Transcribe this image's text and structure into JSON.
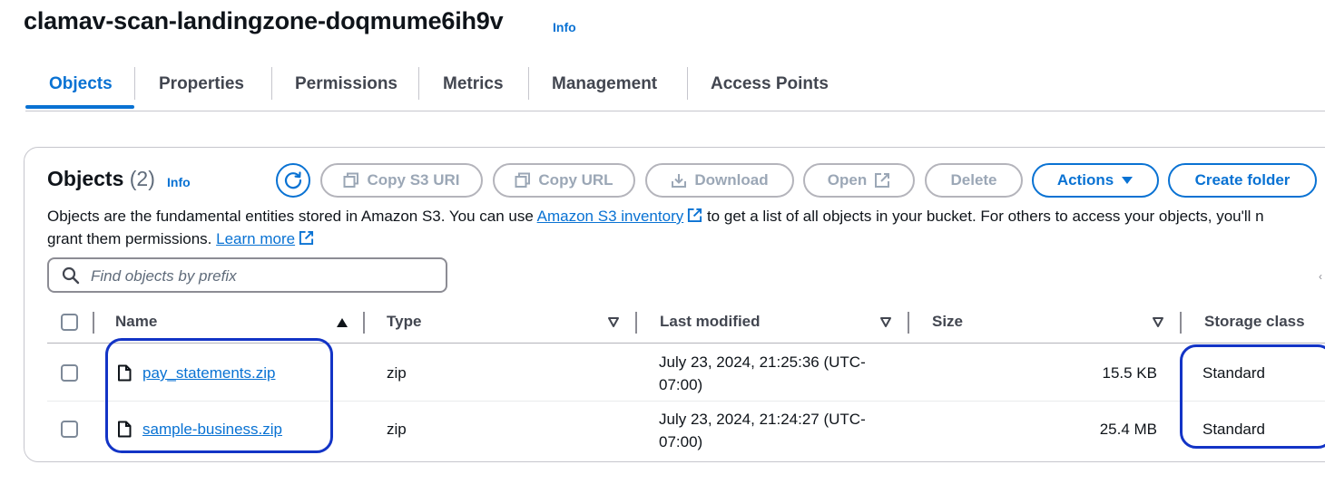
{
  "bucket": {
    "title": "clamav-scan-landingzone-doqmume6ih9v",
    "info": "Info"
  },
  "tabs": [
    {
      "label": "Objects",
      "active": true
    },
    {
      "label": "Properties"
    },
    {
      "label": "Permissions"
    },
    {
      "label": "Metrics"
    },
    {
      "label": "Management"
    },
    {
      "label": "Access Points"
    }
  ],
  "objects_panel": {
    "title": "Objects",
    "count": "(2)",
    "info": "Info",
    "buttons": {
      "copy_s3_uri": "Copy S3 URI",
      "copy_url": "Copy URL",
      "download": "Download",
      "open": "Open",
      "delete": "Delete",
      "actions": "Actions",
      "create_folder": "Create folder"
    },
    "description": {
      "part1": "Objects are the fundamental entities stored in Amazon S3. You can use ",
      "inventory_link": "Amazon S3 inventory",
      "part2": " to get a list of all objects in your bucket. For others to access your objects, you'll n",
      "part3": "grant them permissions. ",
      "learn_more": "Learn more"
    },
    "search": {
      "placeholder": "Find objects by prefix",
      "value": ""
    },
    "columns": {
      "name": "Name",
      "type": "Type",
      "last_modified": "Last modified",
      "size": "Size",
      "storage_class": "Storage class"
    },
    "rows": [
      {
        "name": "pay_statements.zip",
        "type": "zip",
        "last_modified_1": "July 23, 2024, 21:25:36 (UTC-",
        "last_modified_2": "07:00)",
        "size": "15.5 KB",
        "storage_class": "Standard"
      },
      {
        "name": "sample-business.zip",
        "type": "zip",
        "last_modified_1": "July 23, 2024, 21:24:27 (UTC-",
        "last_modified_2": "07:00)",
        "size": "25.4 MB",
        "storage_class": "Standard"
      }
    ]
  },
  "colors": {
    "accent": "#0972d3",
    "disabled": "#9ba7b6",
    "annotation": "#1334c6"
  }
}
